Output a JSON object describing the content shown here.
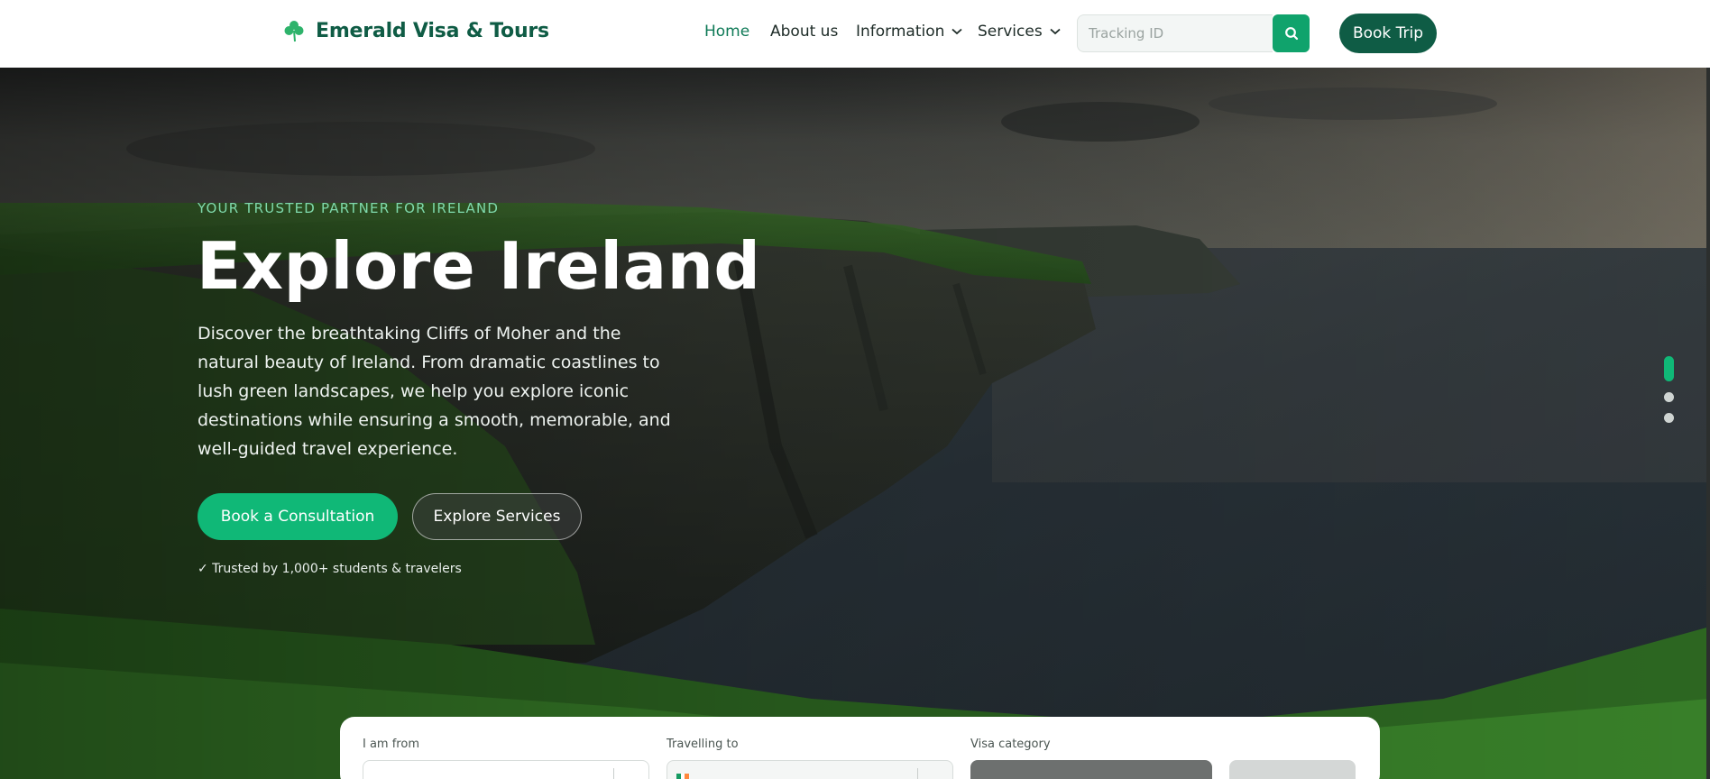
{
  "brand": {
    "name": "Emerald Visa & Tours",
    "logo_icon": "shamrock-icon",
    "color": "#0f5c45"
  },
  "nav": {
    "items": [
      {
        "label": "Home",
        "active": true
      },
      {
        "label": "About us",
        "active": false
      },
      {
        "label": "Information",
        "active": false,
        "has_dropdown": true
      },
      {
        "label": "Services",
        "active": false,
        "has_dropdown": true
      }
    ]
  },
  "search": {
    "placeholder": "Tracking ID",
    "button_icon": "search-icon"
  },
  "header_cta": {
    "label": "Book Trip"
  },
  "hero": {
    "eyebrow": "YOUR TRUSTED PARTNER FOR IRELAND",
    "title": "Explore Ireland",
    "description": "Discover the breathtaking Cliffs of Moher and the natural beauty of Ireland. From dramatic coastlines to lush green landscapes, we help you explore iconic destinations while ensuring a smooth, memorable, and well-guided travel experience.",
    "primary_cta": "Book a Consultation",
    "secondary_cta": "Explore Services",
    "trust_note": "✓ Trusted by 1,000+ students & travelers",
    "slides": {
      "count": 3,
      "active_index": 0
    }
  },
  "booking": {
    "from_label": "I am from",
    "to_label": "Travelling to",
    "visa_label": "Visa category"
  },
  "colors": {
    "accent": "#10b877",
    "dark_green": "#0f5c45",
    "search_button": "#10a36c"
  }
}
